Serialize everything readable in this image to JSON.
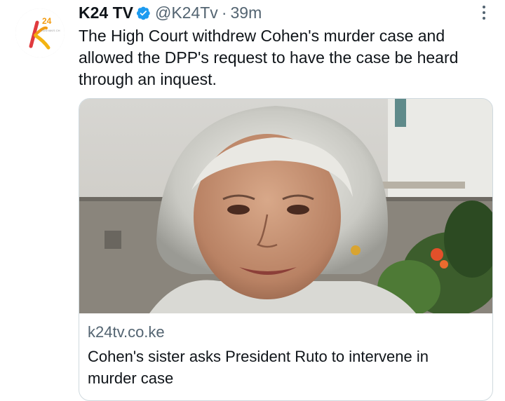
{
  "tweet": {
    "author_name": "K24 TV",
    "handle": "@K24Tv",
    "separator": "·",
    "time": "39m",
    "text": "The High Court withdrew Cohen's murder case and allowed the DPP's request to have the case be heard through an inquest."
  },
  "avatar": {
    "logo_text": "k",
    "logo_superscript": "24",
    "tagline": "KENYAN'S CH"
  },
  "card": {
    "domain": "k24tv.co.ke",
    "title": "Cohen's sister asks President Ruto to intervene in murder case"
  },
  "colors": {
    "verified_badge": "#1d9bf0",
    "secondary_text": "#536471",
    "logo_orange": "#f39c12",
    "logo_red": "#e03a3e"
  }
}
